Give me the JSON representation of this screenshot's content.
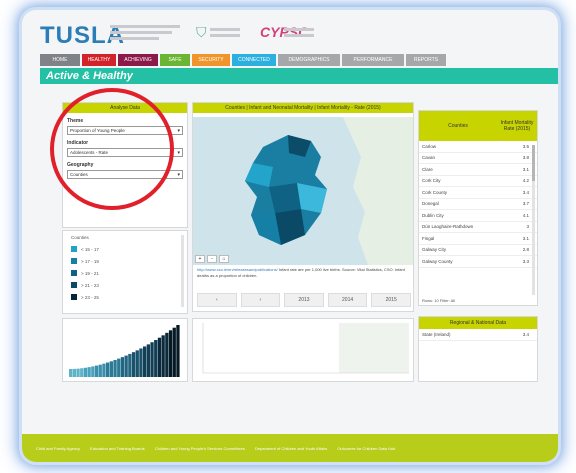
{
  "header": {
    "logo": "TUSLA",
    "cypsc_logo": "CYPSC"
  },
  "nav": {
    "tabs": [
      {
        "label": "HOME",
        "color": "#7f8286"
      },
      {
        "label": "HEALTHY",
        "color": "#d2232a"
      },
      {
        "label": "ACHIEVING",
        "color": "#8b1a4b"
      },
      {
        "label": "SAFE",
        "color": "#6bb535"
      },
      {
        "label": "SECURITY",
        "color": "#f0952b"
      },
      {
        "label": "CONNECTED",
        "color": "#2bb0e0"
      },
      {
        "label": "DEMOGRAPHICS",
        "color": "#a5a7aa"
      },
      {
        "label": "PERFORMANCE",
        "color": "#a5a7aa"
      },
      {
        "label": "REPORTS",
        "color": "#a5a7aa"
      }
    ]
  },
  "page": {
    "title": "Active & Healthy"
  },
  "analyse": {
    "heading": "Analyse Data",
    "theme_label": "Theme",
    "theme_value": "Proportion of Young People",
    "indicator_label": "Indicator",
    "indicator_value": "Adolescents - Rate",
    "geography_label": "Geography",
    "geography_value": "Counties"
  },
  "legend": {
    "title": "Counties",
    "items": [
      {
        "label": "< 15 - 17",
        "color": "#1fa3c9"
      },
      {
        "label": "> 17 - 19",
        "color": "#167fa6"
      },
      {
        "label": "> 19 - 21",
        "color": "#0f6283"
      },
      {
        "label": "> 21 - 23",
        "color": "#0a4a66"
      },
      {
        "label": "> 23 - 25",
        "color": "#06273a"
      }
    ]
  },
  "map": {
    "heading": "Counties | Infant and Neonatal Mortality | Infant Mortality - Rate (2015)",
    "zoom_in": "+",
    "zoom_out": "-",
    "home": "⌂",
    "source_link": "http://www.cso.ie/en/releasesandpublications/",
    "note_text": "Infant rate are per 1,000 live births. Source: Vital Statistics, CSO. Infant deaths as a proportion of children."
  },
  "stats": {
    "prev": "‹",
    "next": "›",
    "values": [
      "2013",
      "2014",
      "2015"
    ]
  },
  "rank": {
    "col_name": "Counties",
    "col_value": "Infant Mortality Rate (2015)",
    "rows": [
      {
        "name": "Carlow",
        "value": "3.5"
      },
      {
        "name": "Cavan",
        "value": "3.8"
      },
      {
        "name": "Clare",
        "value": "3.1"
      },
      {
        "name": "Cork City",
        "value": "4.2"
      },
      {
        "name": "Cork County",
        "value": "3.4"
      },
      {
        "name": "Donegal",
        "value": "3.7"
      },
      {
        "name": "Dublin City",
        "value": "4.1"
      },
      {
        "name": "Dún Laoghaire-Rathdown",
        "value": "3"
      },
      {
        "name": "Fingal",
        "value": "3.1"
      },
      {
        "name": "Galway City",
        "value": "2.8"
      },
      {
        "name": "Galway County",
        "value": "3.3"
      }
    ],
    "footer": "Rows: 10  Filter: All"
  },
  "region": {
    "heading": "Regional & National Data",
    "row_name": "State (Ireland)",
    "row_value": "3.4"
  },
  "bars": {
    "colors": [
      "#5fb3c9",
      "#4aa1bb",
      "#3a8fac",
      "#2d7a96",
      "#236681",
      "#1a526b",
      "#123f55",
      "#0b2b3c",
      "#061a25"
    ]
  },
  "footer": {
    "items": [
      "Child and Family Agency",
      "Education and Training Boards",
      "Children and Young People's Services Committees",
      "Department of Children and Youth Affairs",
      "Outcomes for Children Data Hub"
    ]
  },
  "annotation": {
    "color": "#e0202a"
  }
}
